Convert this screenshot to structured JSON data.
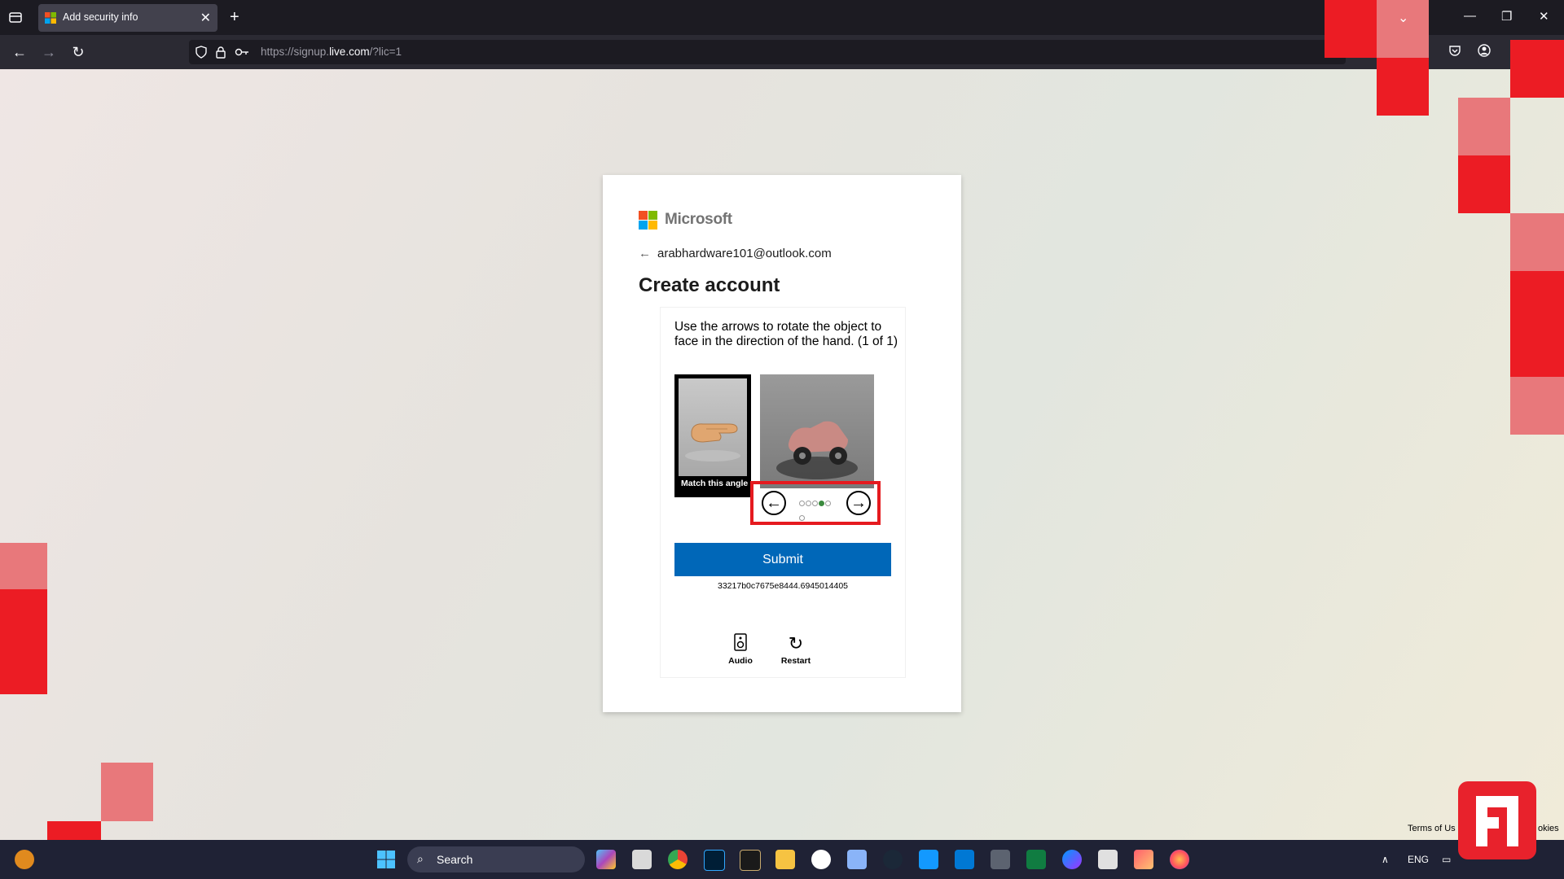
{
  "browser": {
    "tab_title": "Add security info",
    "url_prefix": "https://signup.",
    "url_domain": "live.com",
    "url_suffix": "/?lic=1"
  },
  "page": {
    "brand": "Microsoft",
    "identity": "arabhardware101@outlook.com",
    "title": "Create account"
  },
  "captcha": {
    "instruction": "Use the arrows to rotate the object to face in the direction of the hand. (1 of 1)",
    "reference_label": "Match this angle",
    "dots_total": 6,
    "dots_active_index": 3,
    "submit_label": "Submit",
    "id": "33217b0c7675e8444.6945014405",
    "audio_label": "Audio",
    "restart_label": "Restart"
  },
  "taskbar": {
    "search_placeholder": "Search",
    "language": "ENG"
  },
  "footer": {
    "terms": "Terms of Us",
    "cookies": "okies"
  },
  "colors": {
    "accent": "#0067b8",
    "highlight": "#e51a1f",
    "deco_red": "#ec1c24",
    "deco_pink": "#e8787b"
  }
}
